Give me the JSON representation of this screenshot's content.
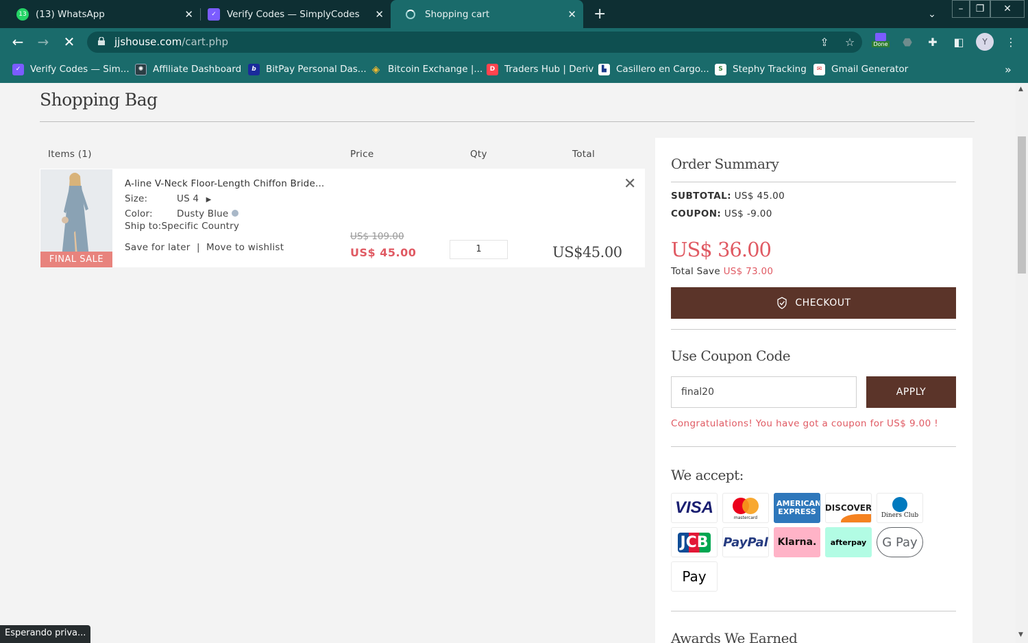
{
  "browser": {
    "tabs": [
      {
        "title": "(13) WhatsApp",
        "badge": "13"
      },
      {
        "title": "Verify Codes — SimplyCodes"
      },
      {
        "title": "Shopping cart"
      }
    ],
    "url_host": "jjshouse.com",
    "url_path": "/cart.php",
    "extension_badge": "Done",
    "bookmarks": [
      {
        "label": "Verify Codes — Sim..."
      },
      {
        "label": "Affiliate Dashboard"
      },
      {
        "label": "BitPay Personal Das..."
      },
      {
        "label": "Bitcoin Exchange |..."
      },
      {
        "label": "Traders Hub | Deriv"
      },
      {
        "label": "Casillero en Cargo..."
      },
      {
        "label": "Stephy Tracking"
      },
      {
        "label": "Gmail Generator"
      }
    ],
    "status_text": "Esperando priva..."
  },
  "cart": {
    "title": "Shopping Bag",
    "columns": {
      "items": "Items (1)",
      "price": "Price",
      "qty": "Qty",
      "total": "Total"
    },
    "item": {
      "name": "A-line V-Neck Floor-Length Chiffon Bride...",
      "size_label": "Size:",
      "size_value": "US 4",
      "color_label": "Color:",
      "color_value": "Dusty Blue",
      "ship_to": "Ship to:Specific Country",
      "save_for_later": "Save for later",
      "separator": "|",
      "move_to_wishlist": "Move to wishlist",
      "badge": "FINAL SALE",
      "old_price": "US$ 109.00",
      "price": "US$ 45.00",
      "qty": "1",
      "total": "US$45.00"
    }
  },
  "summary": {
    "title": "Order Summary",
    "subtotal_label": "SUBTOTAL:",
    "subtotal_value": "US$ 45.00",
    "coupon_label": "COUPON:",
    "coupon_value": "US$ -9.00",
    "grand_total": "US$ 36.00",
    "total_save_label": "Total Save",
    "total_save_value": "US$ 73.00",
    "checkout_label": "CHECKOUT",
    "coupon_heading": "Use Coupon Code",
    "coupon_input_value": "final20",
    "apply_label": "APPLY",
    "coupon_message": "Congratulations! You have got a coupon for US$ 9.00 !",
    "accept_heading": "We accept:",
    "awards_heading": "Awards We Earned",
    "payment_methods": [
      "VISA",
      "mastercard",
      "AMERICAN EXPRESS",
      "DISCOVER",
      "Diners Club",
      "JCB",
      "PayPal",
      "Klarna.",
      "afterpay",
      "G Pay",
      "Pay"
    ]
  },
  "colors": {
    "brand_brown": "#5b3429",
    "sale_red": "#e05a63",
    "chrome_teal": "#1a6b6b",
    "chrome_dark": "#0e2f33"
  }
}
